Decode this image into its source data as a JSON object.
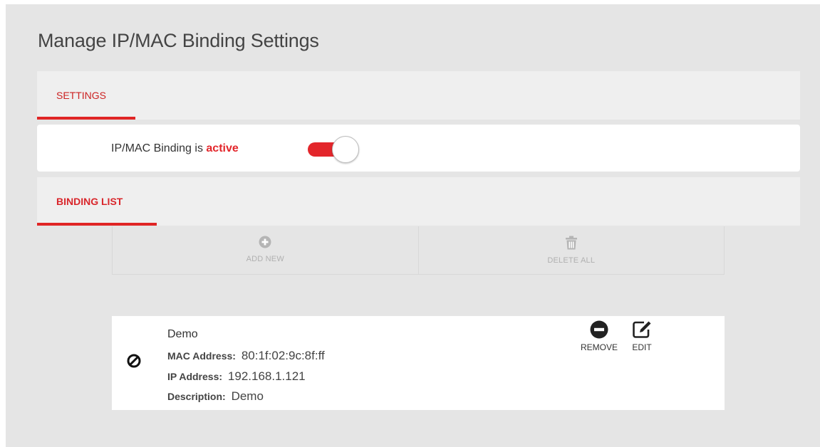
{
  "page": {
    "title": "Manage IP/MAC Binding Settings"
  },
  "settings_section": {
    "tab_label": "SETTINGS",
    "status_prefix": "IP/MAC Binding is",
    "status_value": "active",
    "toggle_on": true
  },
  "binding_section": {
    "tab_label": "BINDING LIST",
    "add_new_label": "ADD NEW",
    "delete_all_label": "DELETE ALL"
  },
  "bindings": [
    {
      "name": "Demo",
      "mac_label": "MAC Address:",
      "mac_value": "80:1f:02:9c:8f:ff",
      "ip_label": "IP Address:",
      "ip_value": "192.168.1.121",
      "desc_label": "Description:",
      "desc_value": "Demo",
      "remove_label": "REMOVE",
      "edit_label": "EDIT"
    }
  ],
  "colors": {
    "accent": "#e3262b",
    "background": "#e5e5e5",
    "muted_icon": "#b5b5b5"
  },
  "icons": {
    "add": "plus-circle-icon",
    "delete_all": "trash-icon",
    "status": "block-icon",
    "remove": "minus-circle-icon",
    "edit": "edit-pencil-icon"
  }
}
